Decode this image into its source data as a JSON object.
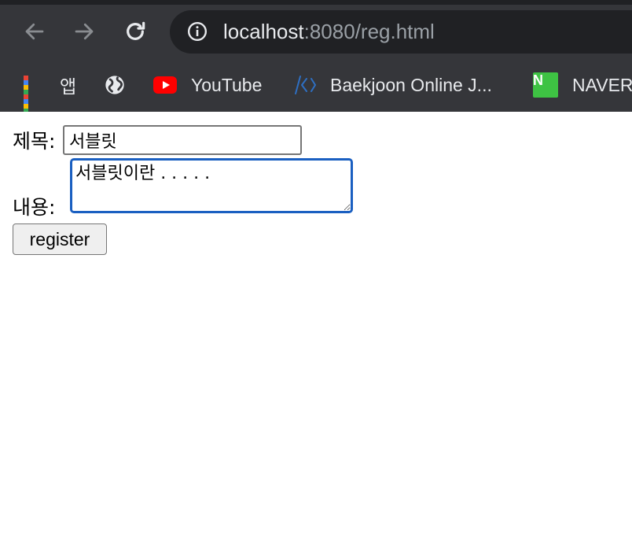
{
  "browser": {
    "url_host": "localhost",
    "url_rest": ":8080/reg.html",
    "bookmarks": [
      {
        "label": "앱",
        "icon": "apps-grid-icon"
      },
      {
        "label": "",
        "icon": "globe-icon"
      },
      {
        "label": "YouTube",
        "icon": "youtube-icon"
      },
      {
        "label": "Baekjoon Online J...",
        "icon": "code-brackets-icon"
      },
      {
        "label": "NAVER",
        "icon": "naver-icon"
      }
    ]
  },
  "form": {
    "title_label": "제목:",
    "title_value": "서블릿",
    "content_label": "내용:",
    "content_value": "서블릿이란 . . . . .",
    "submit_label": "register"
  },
  "colors": {
    "chrome_bg": "#35363a",
    "omnibox_bg": "#202124",
    "focus_ring": "#1a5fc1"
  }
}
